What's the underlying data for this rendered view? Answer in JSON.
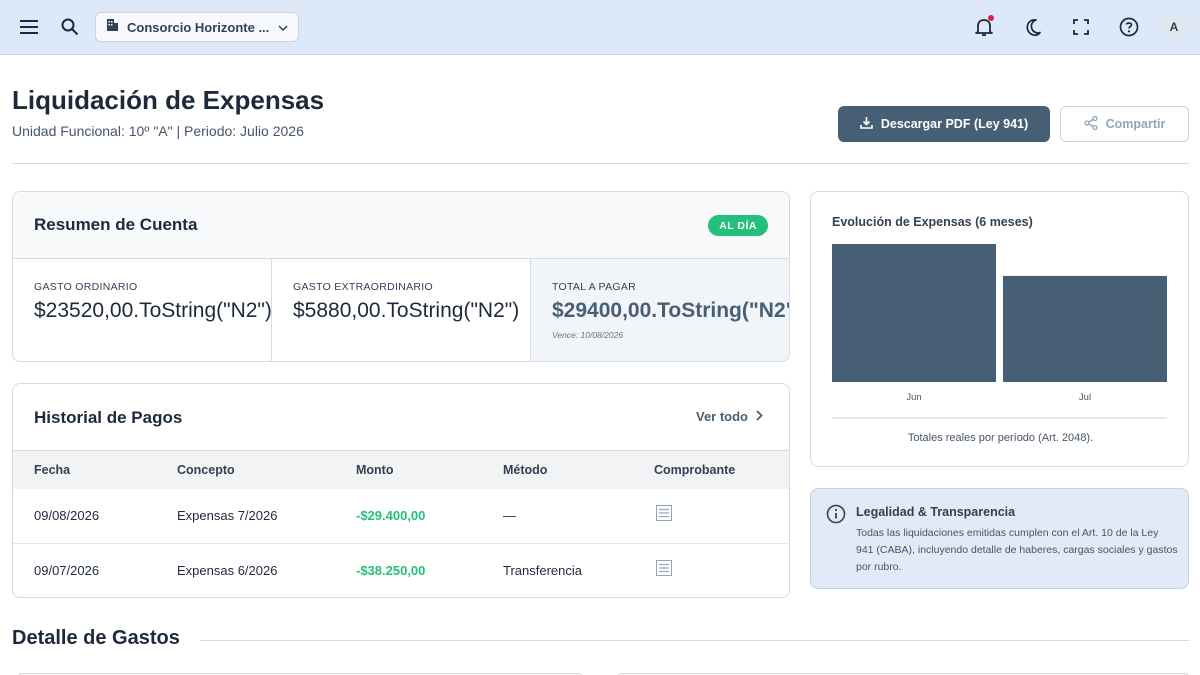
{
  "topbar": {
    "org_name": "Consorcio Horizonte ...",
    "avatar_initial": "A",
    "icons": [
      "menu-icon",
      "search-icon",
      "building-icon",
      "chevron-down-icon",
      "bell-icon",
      "moon-icon",
      "fullscreen-icon",
      "help-icon"
    ],
    "notification_dot_color": "#e11d48"
  },
  "header": {
    "title": "Liquidación de Expensas",
    "subtitle": "Unidad Funcional: 10º \"A\" | Periodo: Julio 2026",
    "download_label": "Descargar PDF (Ley 941)",
    "share_label": "Compartir"
  },
  "resumen": {
    "title": "Resumen de Cuenta",
    "status_badge": "AL DÍA",
    "ordinario_label": "GASTO ORDINARIO",
    "ordinario_value": "$23520,00.ToString(\"N2\")",
    "extra_label": "GASTO EXTRAORDINARIO",
    "extra_value": "$5880,00.ToString(\"N2\")",
    "total_label": "TOTAL A PAGAR",
    "total_value": "$29400,00.ToString(\"N2\")",
    "vence": "Vence: 10/08/2026"
  },
  "historial": {
    "title": "Historial de Pagos",
    "ver_todo": "Ver todo",
    "columns": [
      "Fecha",
      "Concepto",
      "Monto",
      "Método",
      "Comprobante"
    ],
    "rows": [
      {
        "fecha": "09/08/2026",
        "concepto": "Expensas 7/2026",
        "monto": "-$29.400,00",
        "metodo": "—"
      },
      {
        "fecha": "09/07/2026",
        "concepto": "Expensas 6/2026",
        "monto": "-$38.250,00",
        "metodo": "Transferencia"
      }
    ]
  },
  "chart": {
    "title": "Evolución de Expensas (6 meses)",
    "caption": "Totales reales por período (Art. 2048)."
  },
  "chart_data": {
    "type": "bar",
    "title": "Evolución de Expensas (6 meses)",
    "categories": [
      "Jun",
      "Jul"
    ],
    "values": [
      38250,
      29400
    ],
    "ylim": [
      0,
      38250
    ],
    "grid": false,
    "bar_color": "#475f74"
  },
  "legal": {
    "title": "Legalidad & Transparencia",
    "text": "Todas las liquidaciones emitidas cumplen con el Art. 10 de la Ley 941 (CABA), incluyendo detalle de haberes, cargas sociales y gastos por rubro."
  },
  "detalle": {
    "title": "Detalle de Gastos"
  },
  "colors": {
    "accent": "#475f74",
    "success": "#22c07a",
    "topbar_bg": "#dde8f8"
  }
}
